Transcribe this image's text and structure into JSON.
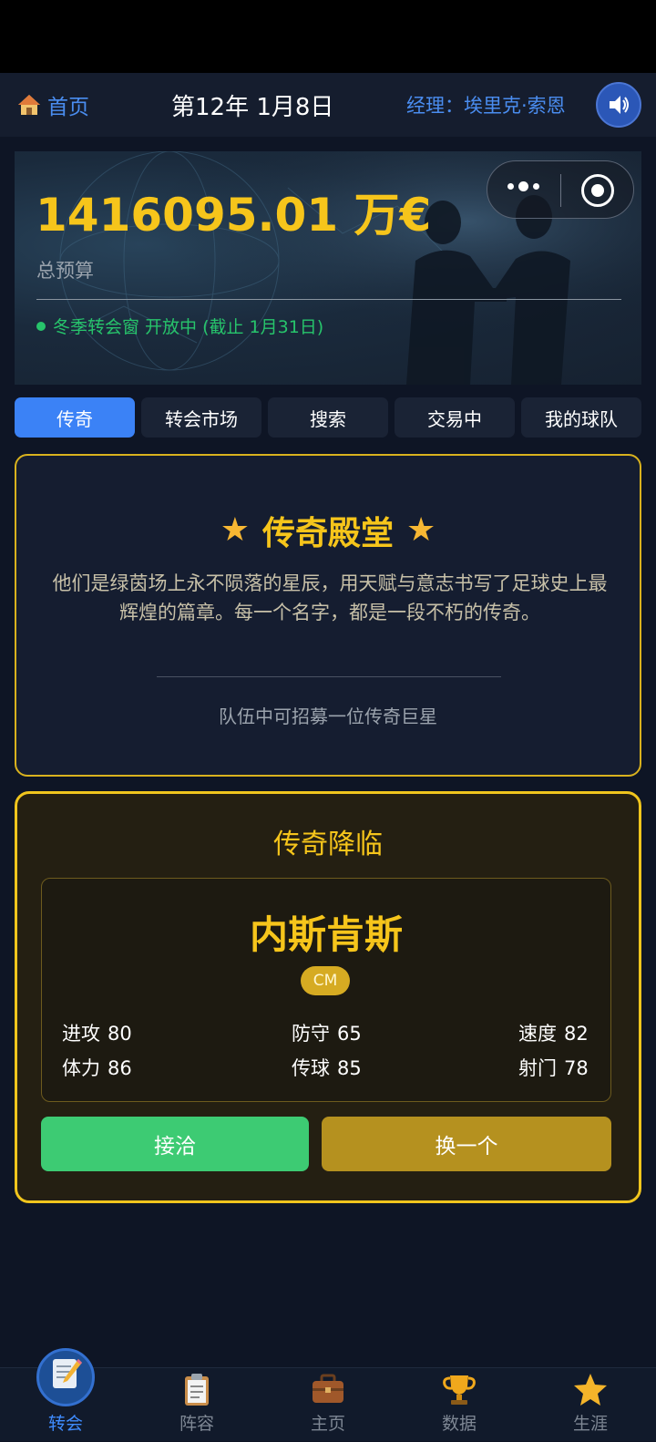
{
  "header": {
    "home_label": "首页",
    "date": "第12年 1月8日",
    "manager": "经理：埃里克·索恩",
    "icons": {
      "home": "house-icon",
      "sound": "speaker-icon"
    }
  },
  "hero": {
    "budget_value": "1416095.01 万€",
    "budget_label": "总预算",
    "window_status": "冬季转会窗 开放中 (截止 1月31日)",
    "status_color": "#27c46b"
  },
  "tabs": [
    {
      "label": "传奇",
      "active": true
    },
    {
      "label": "转会市场",
      "active": false
    },
    {
      "label": "搜索",
      "active": false
    },
    {
      "label": "交易中",
      "active": false
    },
    {
      "label": "我的球队",
      "active": false
    }
  ],
  "legend_hall": {
    "title": "传奇殿堂",
    "description": "他们是绿茵场上永不陨落的星辰，用天赋与意志书写了足球史上最辉煌的篇章。每一个名字，都是一段不朽的传奇。",
    "note": "队伍中可招募一位传奇巨星"
  },
  "arrival": {
    "title": "传奇降临",
    "player": {
      "name": "内斯肯斯",
      "position": "CM",
      "stats": {
        "attack": {
          "label": "进攻",
          "value": "80"
        },
        "defense": {
          "label": "防守",
          "value": "65"
        },
        "speed": {
          "label": "速度",
          "value": "82"
        },
        "stamina": {
          "label": "体力",
          "value": "86"
        },
        "passing": {
          "label": "传球",
          "value": "85"
        },
        "shooting": {
          "label": "射门",
          "value": "78"
        }
      }
    },
    "accept_label": "接洽",
    "swap_label": "换一个"
  },
  "bottom_nav": [
    {
      "label": "转会",
      "icon": "memo-icon",
      "active": true
    },
    {
      "label": "阵容",
      "icon": "clipboard-icon",
      "active": false
    },
    {
      "label": "主页",
      "icon": "briefcase-icon",
      "active": false
    },
    {
      "label": "数据",
      "icon": "trophy-icon",
      "active": false
    },
    {
      "label": "生涯",
      "icon": "star-icon",
      "active": false
    }
  ],
  "colors": {
    "accent_blue": "#3b82f6",
    "gold": "#f6c51b",
    "accept_green": "#3dcb73",
    "swap_gold": "#b5911f"
  }
}
